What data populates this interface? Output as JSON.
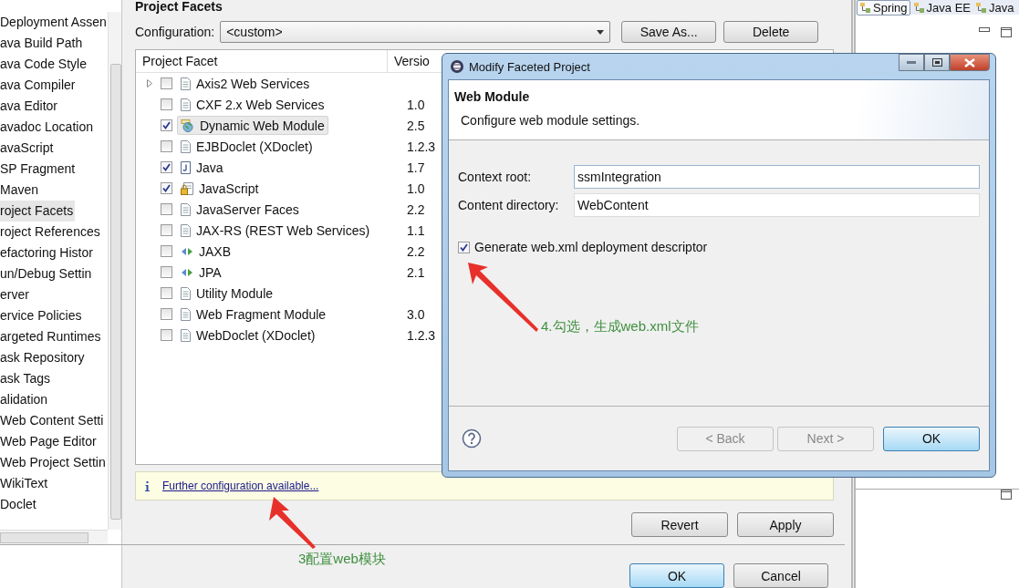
{
  "sidebar": {
    "items": [
      {
        "label": "Deployment Assen",
        "selected": false
      },
      {
        "label": "ava Build Path",
        "selected": false
      },
      {
        "label": "ava Code Style",
        "selected": false
      },
      {
        "label": "ava Compiler",
        "selected": false
      },
      {
        "label": "ava Editor",
        "selected": false
      },
      {
        "label": "avadoc Location",
        "selected": false
      },
      {
        "label": "avaScript",
        "selected": false
      },
      {
        "label": "SP Fragment",
        "selected": false
      },
      {
        "label": "Maven",
        "selected": false
      },
      {
        "label": "roject Facets",
        "selected": true
      },
      {
        "label": "roject References",
        "selected": false
      },
      {
        "label": "efactoring Histor",
        "selected": false
      },
      {
        "label": "un/Debug Settin",
        "selected": false
      },
      {
        "label": "erver",
        "selected": false
      },
      {
        "label": "ervice Policies",
        "selected": false
      },
      {
        "label": "argeted Runtimes",
        "selected": false
      },
      {
        "label": "ask Repository",
        "selected": false
      },
      {
        "label": "ask Tags",
        "selected": false
      },
      {
        "label": "alidation",
        "selected": false
      },
      {
        "label": "Web Content Setti",
        "selected": false
      },
      {
        "label": "Web Page Editor",
        "selected": false
      },
      {
        "label": "Web Project Settin",
        "selected": false
      },
      {
        "label": "WikiText",
        "selected": false
      },
      {
        "label": "Doclet",
        "selected": false
      }
    ]
  },
  "page": {
    "title": "Project Facets",
    "configuration_label": "Configuration:",
    "configuration_value": "<custom>",
    "buttons": [
      "Save As...",
      "Delete"
    ]
  },
  "facets": {
    "columns": [
      "Project Facet",
      "Versio"
    ],
    "rows": [
      {
        "name": "Axis2 Web Services",
        "version": "",
        "checked": false,
        "selected": false,
        "expander": true,
        "kind": "document"
      },
      {
        "name": "CXF 2.x Web Services",
        "version": "1.0",
        "checked": false,
        "selected": false,
        "expander": false,
        "kind": "document"
      },
      {
        "name": "Dynamic Web Module",
        "version": "2.5",
        "checked": true,
        "selected": true,
        "expander": false,
        "kind": "web"
      },
      {
        "name": "EJBDoclet (XDoclet)",
        "version": "1.2.3",
        "checked": false,
        "selected": false,
        "expander": false,
        "kind": "document"
      },
      {
        "name": "Java",
        "version": "1.7",
        "checked": true,
        "selected": false,
        "expander": false,
        "kind": "java"
      },
      {
        "name": "JavaScript",
        "version": "1.0",
        "checked": true,
        "selected": false,
        "expander": false,
        "kind": "script"
      },
      {
        "name": "JavaServer Faces",
        "version": "2.2",
        "checked": false,
        "selected": false,
        "expander": false,
        "kind": "document"
      },
      {
        "name": "JAX-RS (REST Web Services)",
        "version": "1.1",
        "checked": false,
        "selected": false,
        "expander": false,
        "kind": "document"
      },
      {
        "name": "JAXB",
        "version": "2.2",
        "checked": false,
        "selected": false,
        "expander": false,
        "kind": "binding"
      },
      {
        "name": "JPA",
        "version": "2.1",
        "checked": false,
        "selected": false,
        "expander": false,
        "kind": "binding"
      },
      {
        "name": "Utility Module",
        "version": "",
        "checked": false,
        "selected": false,
        "expander": false,
        "kind": "document"
      },
      {
        "name": "Web Fragment Module",
        "version": "3.0",
        "checked": false,
        "selected": false,
        "expander": false,
        "kind": "document"
      },
      {
        "name": "WebDoclet (XDoclet)",
        "version": "1.2.3",
        "checked": false,
        "selected": false,
        "expander": false,
        "kind": "document"
      }
    ]
  },
  "info": {
    "link": "Further configuration available..."
  },
  "page_buttons": [
    "Revert",
    "Apply"
  ],
  "footer_buttons": [
    {
      "label": "OK",
      "default": true
    },
    {
      "label": "Cancel",
      "default": false
    }
  ],
  "perspectives": [
    {
      "label": "Spring",
      "selected": true
    },
    {
      "label": "Java EE",
      "selected": false
    },
    {
      "label": "Java",
      "selected": false
    }
  ],
  "dialog": {
    "title": "Modify Faceted Project",
    "heading": "Web Module",
    "description": "Configure web module settings.",
    "fields": [
      {
        "label": "Context root:",
        "value": "ssmIntegration"
      },
      {
        "label": "Content directory:",
        "value": "WebContent"
      }
    ],
    "checkbox": {
      "label": "Generate web.xml deployment descriptor",
      "checked": true
    },
    "buttons": [
      {
        "label": "< Back",
        "disabled": true,
        "default": false
      },
      {
        "label": "Next >",
        "disabled": true,
        "default": false
      },
      {
        "label": "OK",
        "disabled": false,
        "default": true
      }
    ]
  },
  "annotations": [
    {
      "text": "3配置web模块"
    },
    {
      "text": "4.勾选，生成web.xml文件"
    }
  ]
}
